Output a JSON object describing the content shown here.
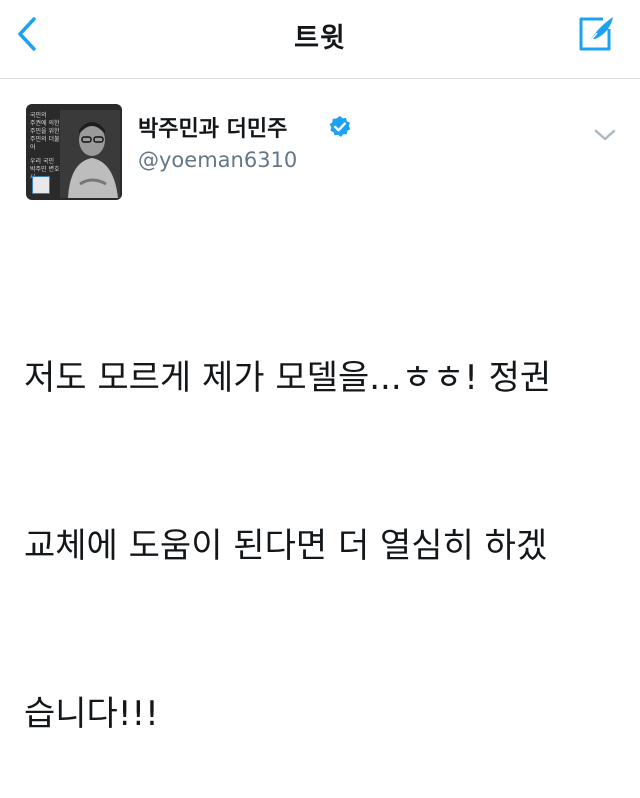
{
  "navbar": {
    "title": "트윗",
    "back_icon": "chevron-left-icon",
    "compose_icon": "compose-quill-icon",
    "accent_color": "#1da1f2"
  },
  "tweet": {
    "display_name": "박주민과 더민주",
    "username": "@yoeman6310",
    "verified": true,
    "menu_icon": "chevron-down-icon",
    "avatar": {
      "text_lines": [
        "국민의",
        "주권에 의한",
        "주민을 위한",
        "주민의 더불어",
        "우리 국민",
        "박주민 변호사"
      ]
    },
    "text_lines": [
      "저도 모르게 제가 모델을...ㅎㅎ! 정권",
      "교체에 도움이 된다면 더 열심히 하겠",
      "습니다!!!"
    ]
  }
}
